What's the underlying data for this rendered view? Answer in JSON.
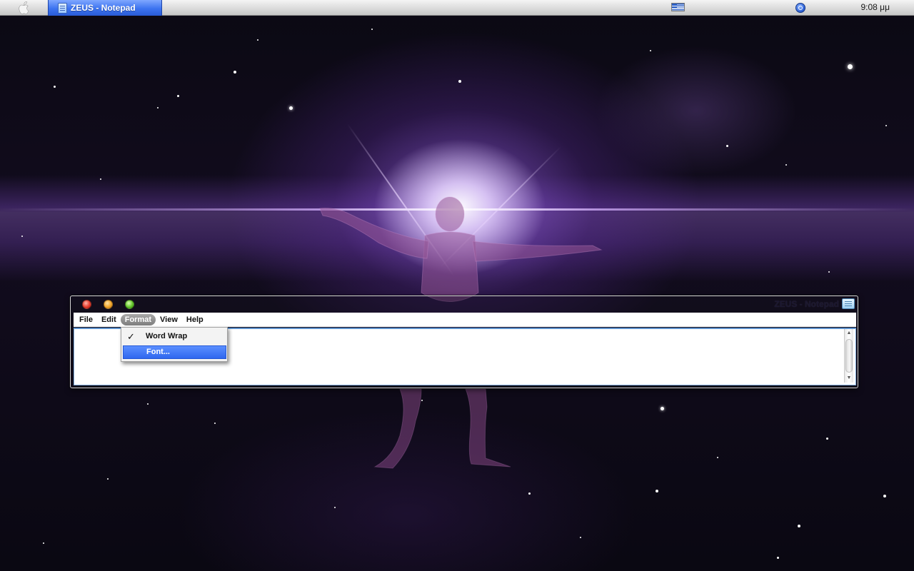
{
  "menubar": {
    "task_label": "ZEUS - Notepad",
    "clock": "9:08 μμ"
  },
  "window": {
    "title": "ZEUS - Notepad",
    "menu": [
      "File",
      "Edit",
      "Format",
      "View",
      "Help"
    ],
    "active_menu": "Format",
    "editor_text": ""
  },
  "format_menu": {
    "items": [
      {
        "label": "Word Wrap",
        "checked": true
      },
      {
        "label": "Font...",
        "highlighted": true
      }
    ]
  },
  "colors": {
    "highlight": "#2f67ef",
    "taskbar_button": "#3c73f0"
  },
  "icons": [
    "apple-logo-icon",
    "notepad-icon",
    "greek-flag-icon",
    "spotlight-icon",
    "close-icon",
    "minimize-icon",
    "maximize-icon"
  ]
}
